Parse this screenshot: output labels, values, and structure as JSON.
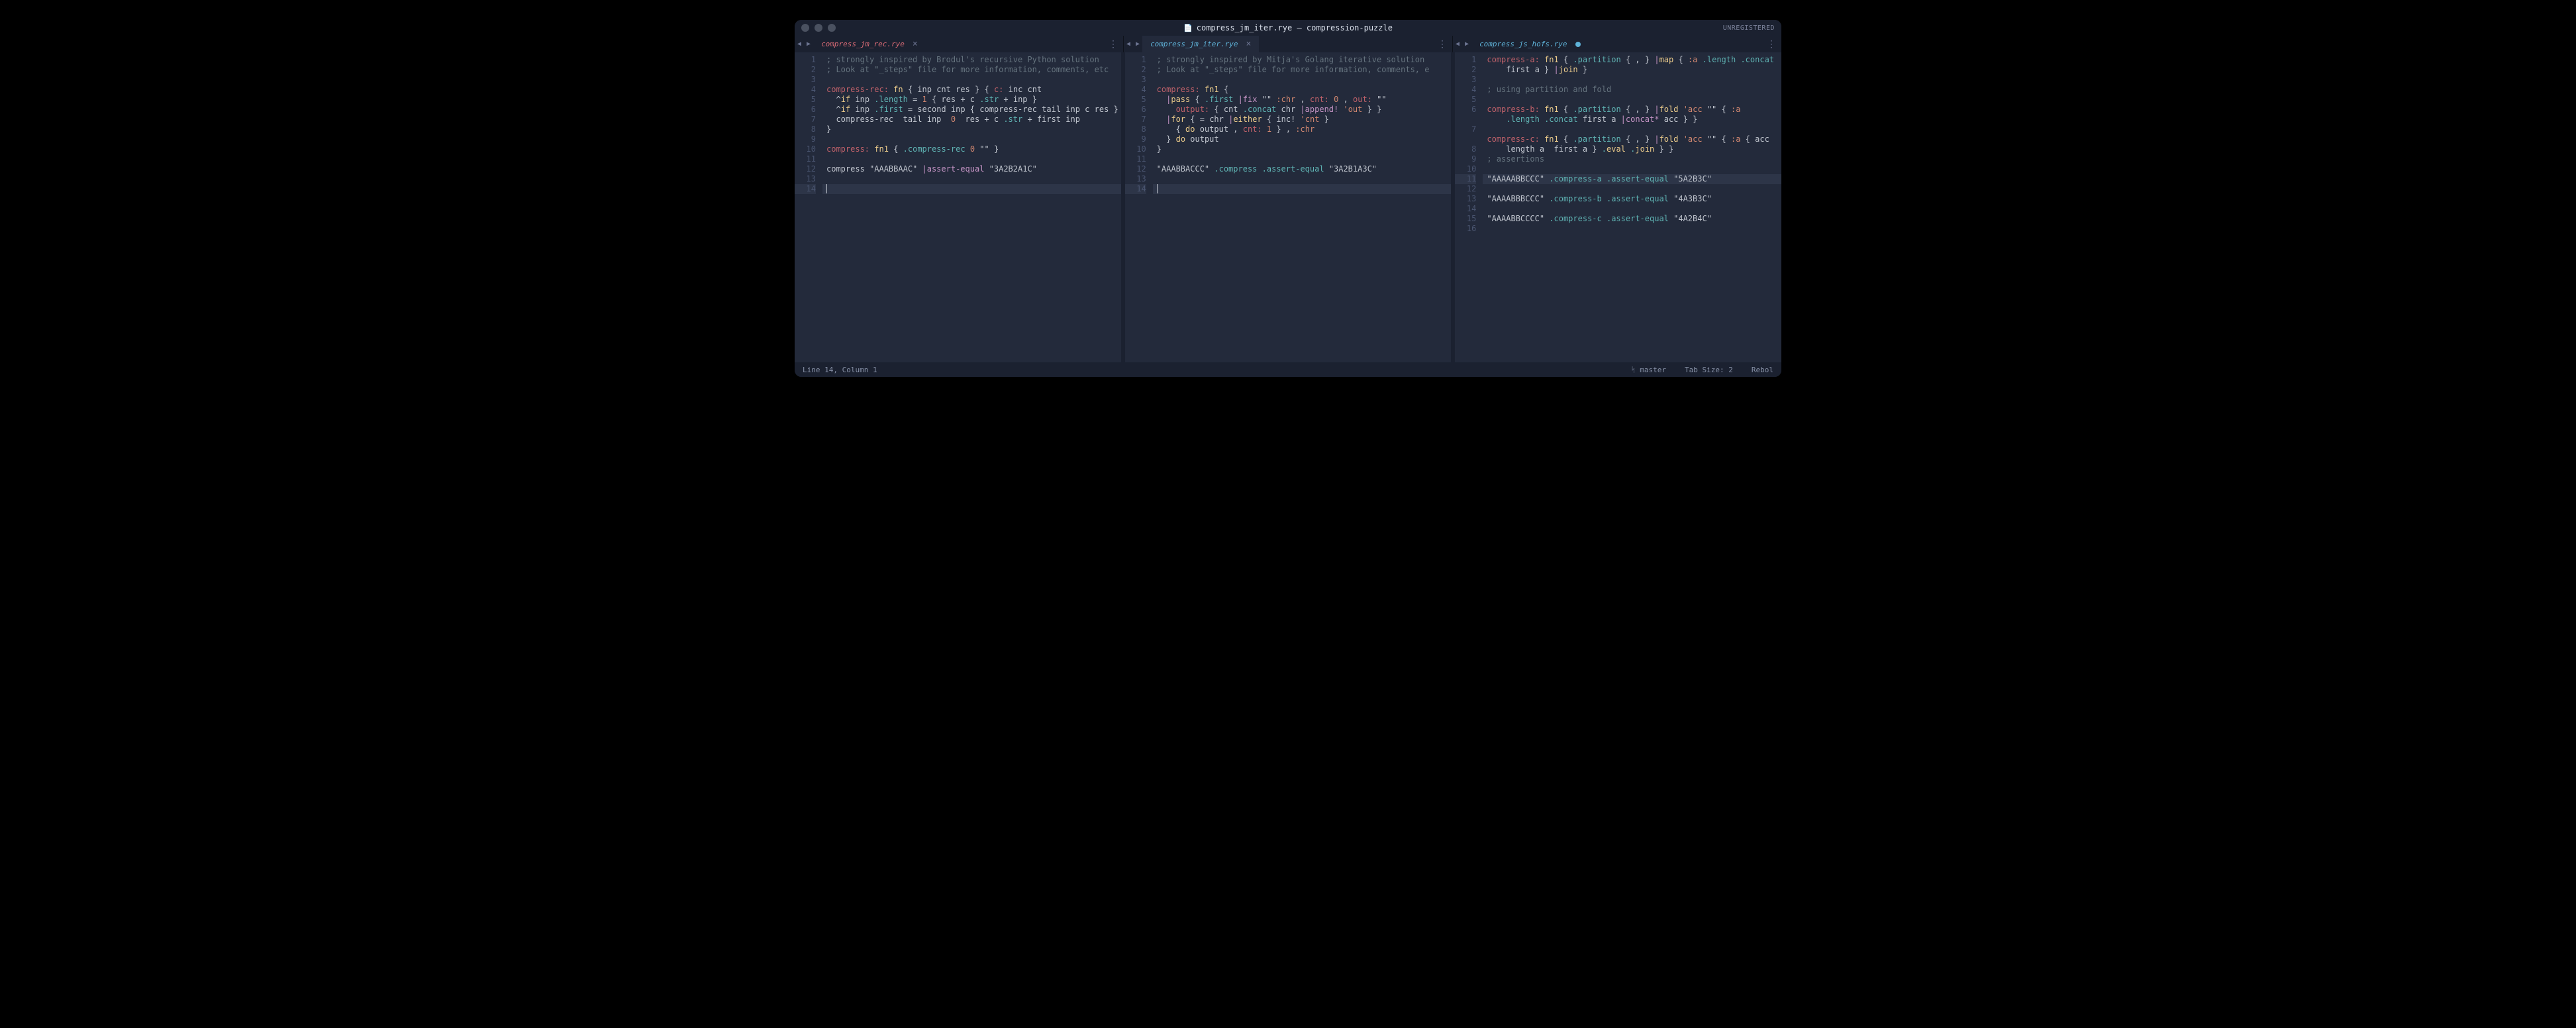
{
  "titlebar": {
    "file_icon": "📄",
    "title": "compress_jm_iter.rye — compression-puzzle",
    "unregistered": "UNREGISTERED"
  },
  "tabs": {
    "pane1": {
      "name": "compress_jm_rec.rye"
    },
    "pane2": {
      "name": "compress_jm_iter.rye"
    },
    "pane3": {
      "name": "compress_js_hofs.rye"
    }
  },
  "glyphs": {
    "close": "×",
    "overflow": "⋮",
    "left": "◀",
    "right": "▶",
    "branch": "ᛋ"
  },
  "statusbar": {
    "cursor_pos": "Line 14, Column 1",
    "branch": "master",
    "tabsize": "Tab Size: 2",
    "syntax": "Rebol"
  },
  "pane1": {
    "line_count": 14,
    "highlight_line": 14,
    "lines": [
      "; strongly inspired by Brodul's recursive Python solution",
      "; Look at \"_steps\" file for more information, comments, etc",
      "",
      "compress-rec: fn { inp cnt res } { c: inc cnt",
      "  ^if inp .length = 1 { res + c .str + inp }",
      "  ^if inp .first = second inp { compress-rec tail inp c res }",
      "  compress-rec  tail inp  0  res + c .str + first inp",
      "}",
      "",
      "compress: fn1 { .compress-rec 0 \"\" }",
      "",
      "compress \"AAABBAAC\" |assert-equal \"3A2B2A1C\"",
      "",
      ""
    ]
  },
  "pane2": {
    "line_count": 14,
    "highlight_line": 14,
    "lines": [
      "; strongly inspired by Mitja's Golang iterative solution",
      "; Look at \"_steps\" file for more information, comments, e",
      "",
      "compress: fn1 {",
      "  |pass { .first |fix \"\" :chr , cnt: 0 , out: \"\"",
      "    output: { cnt .concat chr |append! 'out } }",
      "  |for { = chr |either { inc! 'cnt }",
      "    { do output , cnt: 1 } , :chr",
      "  } do output",
      "}",
      "",
      "\"AAABBACCC\" .compress .assert-equal \"3A2B1A3C\"",
      "",
      ""
    ]
  },
  "pane3": {
    "line_count": 16,
    "highlight_line": 11,
    "lines": [
      "compress-a: fn1 { .partition { , } |map { :a .length .concat",
      "    first a } |join }",
      "",
      "; using partition and fold",
      "",
      "compress-b: fn1 { .partition { , } |fold 'acc \"\" { :a",
      "    .length .concat first a |concat* acc } }",
      "",
      "compress-c: fn1 { .partition { , } |fold 'acc \"\" { :a { acc",
      "    length a  first a } .eval .join } }",
      "; assertions",
      "",
      "\"AAAAABBCCC\" .compress-a .assert-equal \"5A2B3C\"",
      "",
      "\"AAAABBBCCC\" .compress-b .assert-equal \"4A3B3C\"",
      "",
      "\"AAAABBCCCC\" .compress-c .assert-equal \"4A2B4C\"",
      ""
    ],
    "line_numbers": [
      1,
      2,
      3,
      4,
      5,
      6,
      "",
      7,
      "",
      8,
      9,
      10,
      11,
      12,
      13,
      14,
      15,
      16
    ]
  }
}
